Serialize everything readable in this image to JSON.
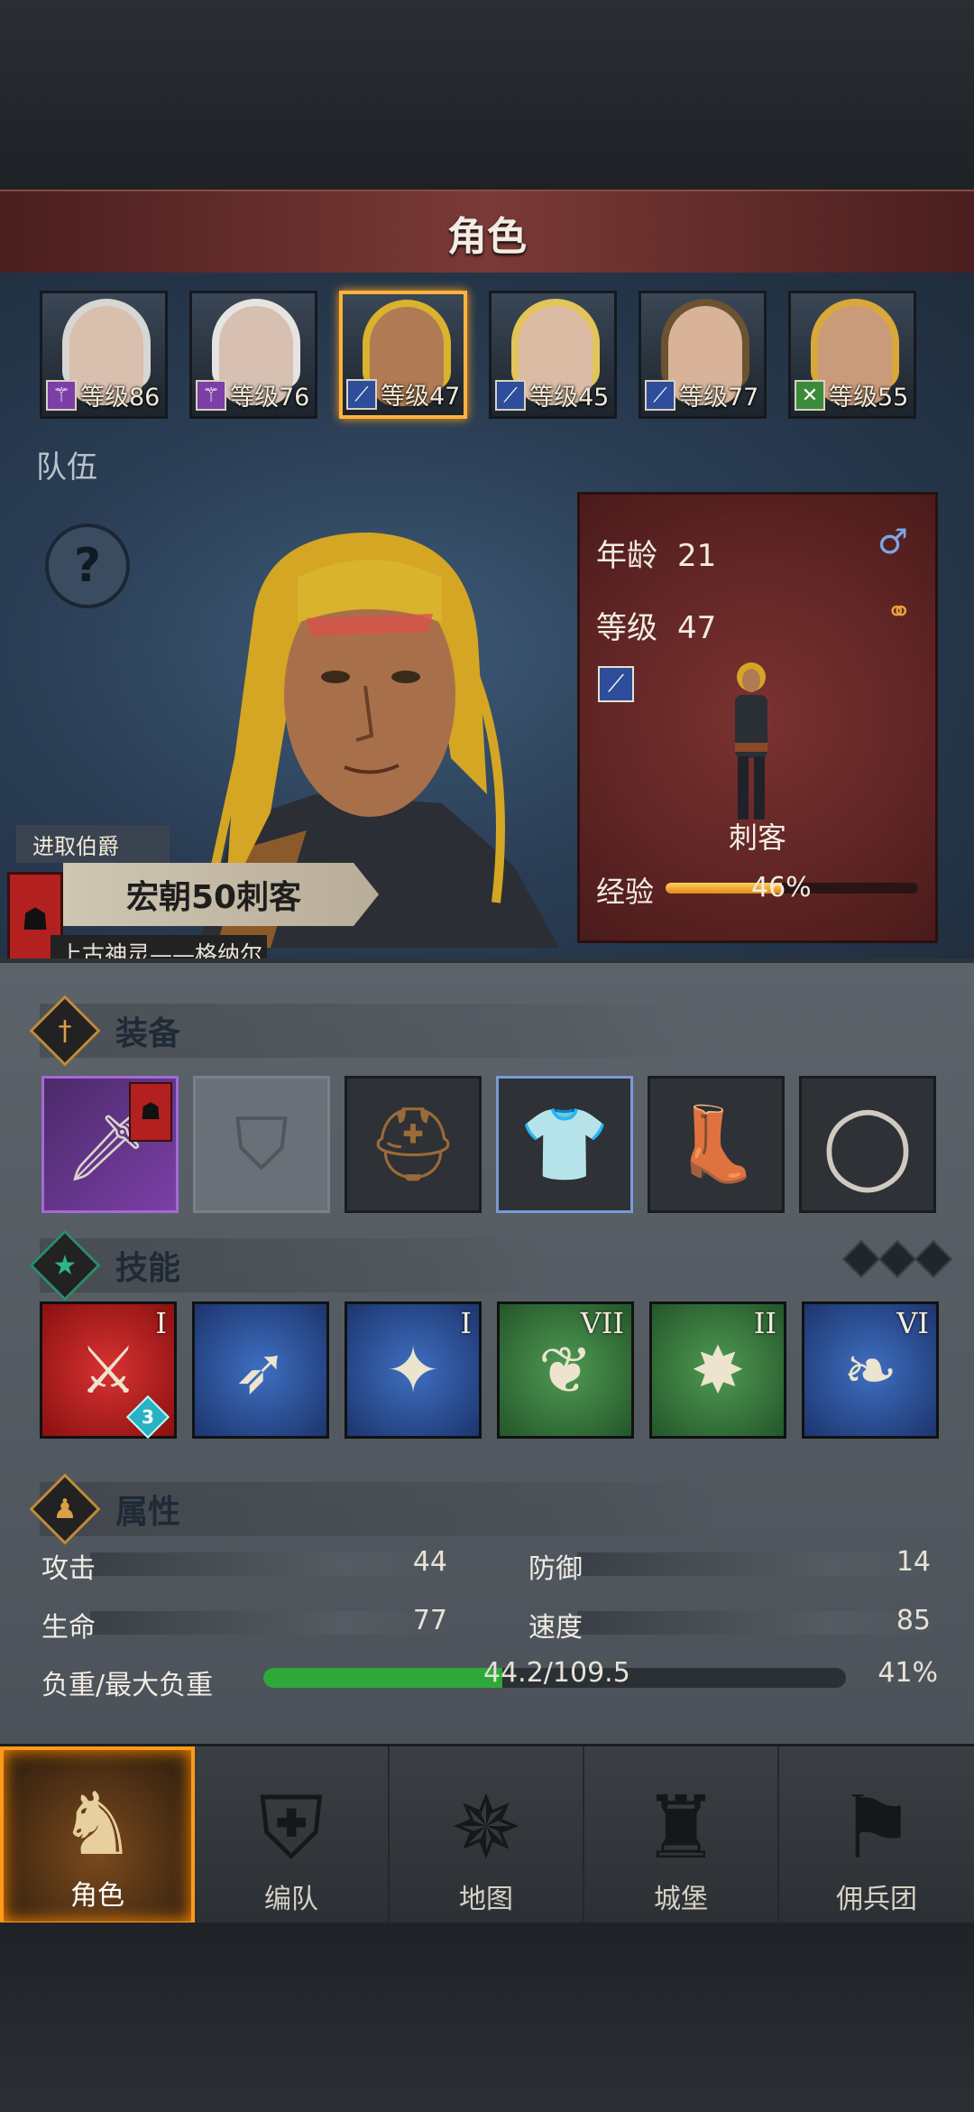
{
  "header": {
    "title": "角色"
  },
  "roster": [
    {
      "level_text": "等级86",
      "class_icon": "staff-icon",
      "class_color": "#7b3fa6",
      "hair": "#d8d6d2",
      "skin": "#d9bfae",
      "selected": false
    },
    {
      "level_text": "等级76",
      "class_icon": "staff-icon",
      "class_color": "#7b3fa6",
      "hair": "#e6e4e0",
      "skin": "#d7c0b2",
      "selected": false
    },
    {
      "level_text": "等级47",
      "class_icon": "dagger-icon",
      "class_color": "#2e4d9a",
      "hair": "#d9b22e",
      "skin": "#b07a55",
      "selected": true
    },
    {
      "level_text": "等级45",
      "class_icon": "dagger-icon",
      "class_color": "#2e4d9a",
      "hair": "#e2c45a",
      "skin": "#dcbba5",
      "selected": false
    },
    {
      "level_text": "等级77",
      "class_icon": "dagger-icon",
      "class_color": "#2e4d9a",
      "hair": "#6b5230",
      "skin": "#d8b39a",
      "selected": false
    },
    {
      "level_text": "等级55",
      "class_icon": "bow-icon",
      "class_color": "#3a8a3a",
      "hair": "#d9a83a",
      "skin": "#c99b7a",
      "selected": false
    }
  ],
  "team_label": "队伍",
  "help_symbol": "?",
  "info": {
    "age_label": "年龄",
    "age": "21",
    "level_label": "等级",
    "level": "47",
    "class_name": "刺客",
    "exp_label": "经验",
    "exp_pct_text": "46%",
    "exp_fraction": 0.46
  },
  "titles": {
    "noble": "进取伯爵",
    "name": "宏朝50刺客",
    "god": "上古神灵——格纳尔"
  },
  "sections": {
    "equipment": "装备",
    "skills": "技能",
    "attributes": "属性"
  },
  "equipment": [
    {
      "name": "sword",
      "icon": "⚔"
    },
    {
      "name": "shield-empty",
      "icon": "⛉"
    },
    {
      "name": "helmet",
      "icon": "⛑"
    },
    {
      "name": "armor",
      "icon": "🛡"
    },
    {
      "name": "boots",
      "icon": "👢"
    },
    {
      "name": "ring",
      "icon": "◯"
    }
  ],
  "skills": [
    {
      "color": "red",
      "rank": "I",
      "glyph": "⚔",
      "gem": "3"
    },
    {
      "color": "blue",
      "rank": "",
      "glyph": "➶",
      "gem": ""
    },
    {
      "color": "blue",
      "rank": "I",
      "glyph": "✦",
      "gem": ""
    },
    {
      "color": "green",
      "rank": "VII",
      "glyph": "❦",
      "gem": ""
    },
    {
      "color": "green",
      "rank": "II",
      "glyph": "✸",
      "gem": ""
    },
    {
      "color": "blue",
      "rank": "VI",
      "glyph": "❧",
      "gem": ""
    }
  ],
  "attributes": {
    "attack_label": "攻击",
    "attack": "44",
    "defense_label": "防御",
    "defense": "14",
    "hp_label": "生命",
    "hp": "77",
    "speed_label": "速度",
    "speed": "85",
    "load_label": "负重/最大负重",
    "load_text": "44.2/109.5",
    "load_pct": "41%",
    "load_fraction": 0.41
  },
  "nav": [
    {
      "label": "角色",
      "icon": "♞",
      "active": true
    },
    {
      "label": "编队",
      "icon": "⛨",
      "active": false
    },
    {
      "label": "地图",
      "icon": "✵",
      "active": false
    },
    {
      "label": "城堡",
      "icon": "♜",
      "active": false
    },
    {
      "label": "佣兵团",
      "icon": "⚑",
      "active": false
    }
  ],
  "colors": {
    "accent": "#ffb33a",
    "title_bar": "#7a3a37",
    "load_fill": "#2fa83a"
  }
}
